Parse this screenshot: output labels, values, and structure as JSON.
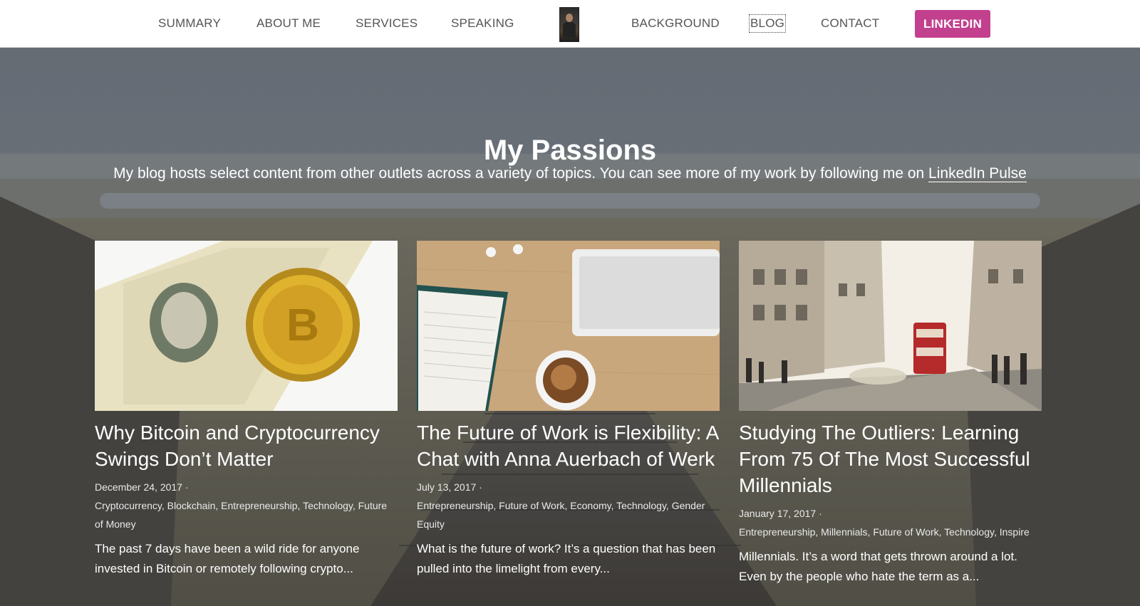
{
  "nav": {
    "left_items": [
      "SUMMARY",
      "ABOUT ME",
      "SERVICES",
      "SPEAKING"
    ],
    "right_items": [
      "BACKGROUND",
      "BLOG",
      "CONTACT"
    ],
    "active_item": "BLOG",
    "linkedin_label": "LINKEDIN",
    "linkedin_color": "#c2408e"
  },
  "hero": {
    "title": "My Passions",
    "intro_text": "My blog hosts select content from other outlets across a variety of topics. You can see more of my work by following me on ",
    "intro_link": "LinkedIn Pulse"
  },
  "posts": [
    {
      "title": "Why Bitcoin and Cryptocurrency Swings Don’t Matter",
      "date": "December 24, 2017",
      "tags": "Cryptocurrency, Blockchain, Entrepreneurship, Technology, Future of Money",
      "excerpt": "The past 7 days have been a wild ride for anyone invested in Bitcoin or remotely following crypto..."
    },
    {
      "title": "The Future of Work is Flexibility: A Chat with Anna Auerbach of Werk",
      "date": "July 13, 2017",
      "tags": "Entrepreneurship, Future of Work, Economy, Technology, Gender Equity",
      "excerpt": "What is the future of work? It’s a question that has been pulled into the limelight from every..."
    },
    {
      "title": "Studying The Outliers: Learning From 75 Of The Most Successful Millennials",
      "date": "January 17, 2017",
      "tags": "Entrepreneurship, Millennials, Future of Work, Technology, Inspire",
      "excerpt": "Millennials. It’s a word that gets thrown around a lot. Even by the people who hate the term as a..."
    }
  ],
  "meta_separator": " ·"
}
